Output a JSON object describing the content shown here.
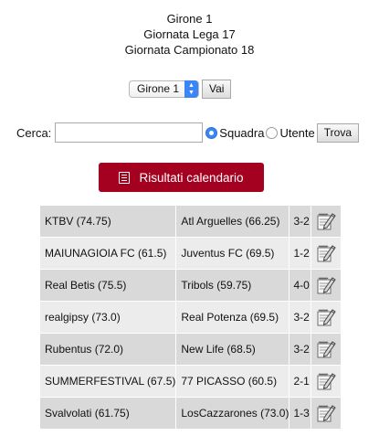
{
  "header": {
    "line1": "Girone 1",
    "line2": "Giornata Lega 17",
    "line3": "Giornata Campionato 18"
  },
  "group_select": {
    "selected": "Girone 1",
    "go_label": "Vai"
  },
  "search": {
    "label": "Cerca:",
    "input_value": "",
    "option_team": "Squadra",
    "option_user": "Utente",
    "selected_option": "Squadra",
    "submit_label": "Trova"
  },
  "calendar_button": {
    "label": "Risultati calendario",
    "color": "#a4001f"
  },
  "matches": [
    {
      "home": "KTBV (74.75)",
      "away": "Atl Arguelles (66.25)",
      "score": "3-2"
    },
    {
      "home": "MAIUNAGIOIA FC (61.5)",
      "away": "Juventus FC (69.5)",
      "score": "1-2"
    },
    {
      "home": "Real Betis (75.5)",
      "away": "Tribols (59.75)",
      "score": "4-0"
    },
    {
      "home": "realgipsy (73.0)",
      "away": "Real Potenza (69.5)",
      "score": "3-2"
    },
    {
      "home": "Rubentus (72.0)",
      "away": "New Life (68.5)",
      "score": "3-2"
    },
    {
      "home": "SUMMERFESTIVAL (67.5)",
      "away": "77 PICASSO (60.5)",
      "score": "2-1"
    },
    {
      "home": "Svalvolati (61.75)",
      "away": "LosCazzarones (73.0)",
      "score": "1-3"
    }
  ],
  "icons": {
    "edit": "edit-notepad-icon",
    "calendar": "calendar-list-icon",
    "select": "chevron-updown-icon"
  }
}
